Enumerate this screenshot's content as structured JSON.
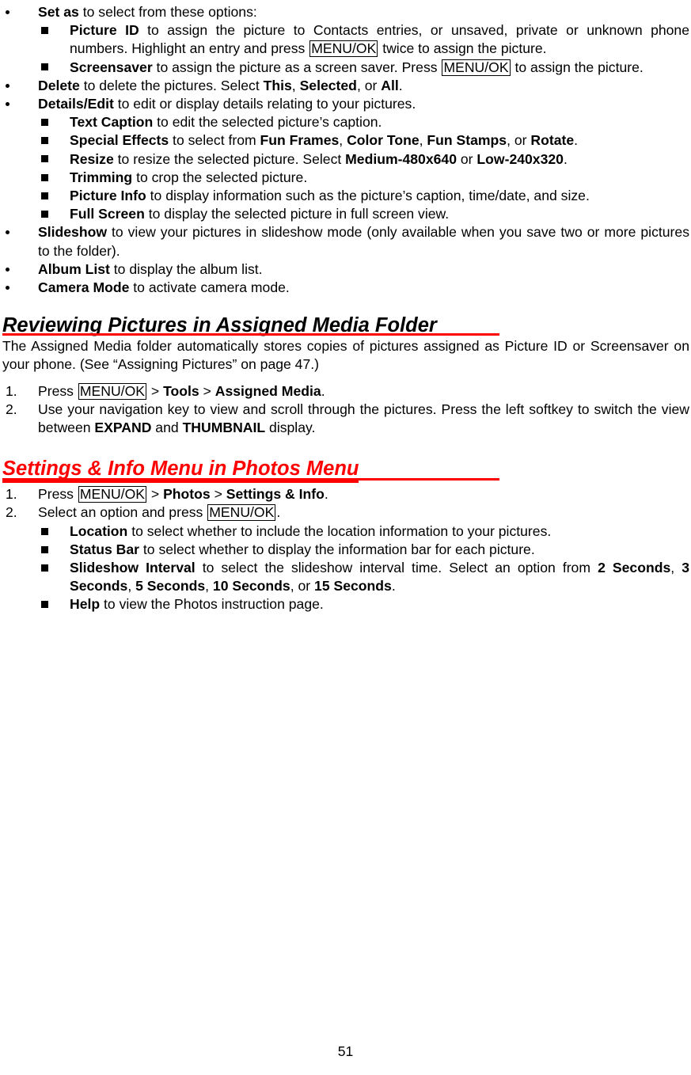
{
  "page": {
    "number": "51"
  },
  "blocks": {
    "set_as": {
      "bold": "Set as",
      "rest": " to select from these options:"
    },
    "picture_id": {
      "bold": "Picture ID",
      "part1": " to assign the picture to Contacts entries, or unsaved, private or unknown phone numbers. Highlight an entry and press ",
      "key": "MENU/OK",
      "part2": " twice to assign the picture."
    },
    "screensaver": {
      "bold": "Screensaver",
      "part1": " to assign the picture as a screen saver. Press ",
      "key": "MENU/OK",
      "part2": " to assign the picture."
    },
    "delete": {
      "bold": "Delete",
      "part1": " to delete the pictures. Select ",
      "opt1": "This",
      "sep1": ", ",
      "opt2": "Selected",
      "sep2": ", or ",
      "opt3": "All",
      "end": "."
    },
    "details_edit": {
      "bold": "Details/Edit",
      "rest": " to edit or display details relating to your pictures."
    },
    "text_caption": {
      "bold": "Text Caption",
      "rest": " to edit the selected picture’s caption."
    },
    "special_effects": {
      "bold": "Special Effects",
      "part1": " to select from ",
      "opt1": "Fun Frames",
      "sep1": ", ",
      "opt2": "Color Tone",
      "sep2": ", ",
      "opt3": "Fun Stamps",
      "sep3": ", or ",
      "opt4": "Rotate",
      "end": "."
    },
    "resize": {
      "bold": "Resize",
      "part1": " to resize the selected picture. Select ",
      "opt1": "Medium-480x640",
      "sep1": " or ",
      "opt2": "Low-240x320",
      "end": "."
    },
    "trimming": {
      "bold": "Trimming",
      "rest": " to crop the selected picture."
    },
    "picture_info": {
      "bold": "Picture Info",
      "rest": " to display information such as the picture’s caption, time/date, and size."
    },
    "full_screen": {
      "bold": "Full Screen",
      "rest": " to display the selected picture in full screen view."
    },
    "slideshow": {
      "bold": "Slideshow",
      "rest": " to view your pictures in slideshow mode (only available when you save two or more pictures to the folder)."
    },
    "album_list": {
      "bold": "Album List",
      "rest": " to display the album list."
    },
    "camera_mode": {
      "bold": "Camera Mode",
      "rest": " to activate camera mode."
    }
  },
  "section_reviewing": {
    "heading": "Reviewing Pictures in Assigned Media Folder",
    "intro": "The Assigned Media folder automatically stores copies of pictures assigned as Picture ID or Screensaver on your phone. (See “Assigning Pictures” on page 47.)",
    "steps": [
      {
        "number": "1.",
        "pre": "Press ",
        "key": "MENU/OK",
        "mid": " > ",
        "b1": "Tools",
        "mid2": " > ",
        "b2": "Assigned Media",
        "end": "."
      },
      {
        "number": "2.",
        "pre": "Use your navigation key to view and scroll through the pictures. Press the left softkey to switch the view between ",
        "b1": "EXPAND",
        "mid": " and ",
        "b2": "THUMBNAIL",
        "end": " display."
      }
    ]
  },
  "section_settings": {
    "heading": "Settings & Info Menu in Photos Menu",
    "steps": [
      {
        "number": "1.",
        "pre": "Press ",
        "key": "MENU/OK",
        "mid": " > ",
        "b1": "Photos",
        "mid2": " > ",
        "b2": "Settings & Info",
        "end": "."
      },
      {
        "number": "2.",
        "pre": "Select an option and press ",
        "key": "MENU/OK",
        "end": "."
      }
    ],
    "options": {
      "location": {
        "bold": "Location",
        "rest": " to select whether to include the location information to your pictures."
      },
      "status_bar": {
        "bold": "Status Bar",
        "rest": " to select whether to display the information bar for each picture."
      },
      "slideshow_interval": {
        "bold": "Slideshow Interval",
        "part1": " to select the slideshow interval time. Select an option from ",
        "opt1": "2 Seconds",
        "sep1": ", ",
        "opt2": "3 Seconds",
        "sep2": ", ",
        "opt3": "5 Seconds",
        "sep3": ", ",
        "opt4": "10 Seconds",
        "sep4": ", or ",
        "opt5": "15 Seconds",
        "end": "."
      },
      "help": {
        "bold": "Help",
        "rest": " to view the Photos instruction page."
      }
    }
  },
  "colors": {
    "heading_red": "#ff0000",
    "text": "#000000"
  }
}
